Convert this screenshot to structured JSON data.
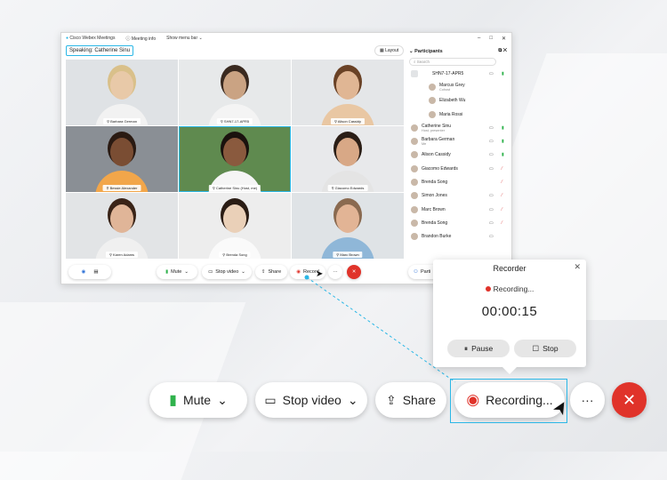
{
  "app": {
    "title": "Cisco Webex Meetings",
    "meeting_info": "Meeting info",
    "menu_bar": "Show menu bar",
    "speaking": "Speaking: Catherine Sinu",
    "layout": "Layout"
  },
  "tiles": [
    {
      "name": "Barbara German",
      "skin": "#e8c9a8",
      "hair": "#d9c08a",
      "shirt": "#f2f2f2",
      "bg": "#dfe2e5"
    },
    {
      "name": "SHN7-17-APR5",
      "skin": "#caa383",
      "hair": "#3a2a20",
      "shirt": "#f4f4f4",
      "bg": "#e7e9ea"
    },
    {
      "name": "Alison Cassidy",
      "skin": "#e0b694",
      "hair": "#6a4226",
      "shirt": "#e9c7a3",
      "bg": "#e4e6e8"
    },
    {
      "name": "Bessie Alexander",
      "skin": "#7a4d33",
      "hair": "#2a1a12",
      "shirt": "#f2a64a",
      "bg": "#8a8f95"
    },
    {
      "name": "Catherine Sinu (Host, me)",
      "skin": "#8a5a3e",
      "hair": "#1a120e",
      "shirt": "#f5f5f5",
      "bg": "#5f8a4f"
    },
    {
      "name": "Giacomo Edwards",
      "skin": "#d8a886",
      "hair": "#2b1e16",
      "shirt": "#e4e4e4",
      "bg": "#e8e9eb"
    },
    {
      "name": "Karen Adams",
      "skin": "#e0b598",
      "hair": "#3a2418",
      "shirt": "#f0f0f0",
      "bg": "#e2e4e6"
    },
    {
      "name": "Brenda Song",
      "skin": "#ead0b8",
      "hair": "#2a1c14",
      "shirt": "#fafafa",
      "bg": "#ededed"
    },
    {
      "name": "Marc Brown",
      "skin": "#e2b495",
      "hair": "#8a6a50",
      "shirt": "#8fb7d8",
      "bg": "#dfe3e6"
    }
  ],
  "participants": {
    "title": "Participants",
    "search_placeholder": "Search",
    "items": [
      {
        "name": "SHN7-17-APR5",
        "sub": "",
        "cam": "video",
        "mic": "on"
      },
      {
        "name": "Marcus Grey",
        "sub": "Cohost",
        "cam": "",
        "mic": "",
        "indent": true
      },
      {
        "name": "Elizabeth Wu",
        "sub": "",
        "cam": "",
        "mic": "",
        "indent": true,
        "initials": "EW"
      },
      {
        "name": "Maria Rossi",
        "sub": "",
        "cam": "",
        "mic": "",
        "indent": true
      },
      {
        "name": "Catherine Sinu",
        "sub": "Host, presenter",
        "cam": "video",
        "mic": "on"
      },
      {
        "name": "Barbara German",
        "sub": "Me",
        "cam": "video",
        "mic": "on"
      },
      {
        "name": "Alison Cassidy",
        "sub": "",
        "cam": "video",
        "mic": "on"
      },
      {
        "name": "Giacomo Edwards",
        "sub": "",
        "cam": "video",
        "mic": "muted"
      },
      {
        "name": "Brenda Song",
        "sub": "",
        "cam": "",
        "mic": "muted"
      },
      {
        "name": "Simon Jones",
        "sub": "",
        "cam": "video",
        "mic": "muted"
      },
      {
        "name": "Marc Brown",
        "sub": "",
        "cam": "video",
        "mic": "muted"
      },
      {
        "name": "Brenda Song",
        "sub": "",
        "cam": "video",
        "mic": "muted"
      },
      {
        "name": "Brandon Burke",
        "sub": "",
        "cam": "video",
        "mic": ""
      }
    ]
  },
  "small_toolbar": {
    "mute": "Mute",
    "stop_video": "Stop video",
    "share": "Share",
    "record": "Record",
    "more": "···",
    "participants": "Parti"
  },
  "recorder": {
    "title": "Recorder",
    "status": "Recording...",
    "timer": "00:00:15",
    "pause": "Pause",
    "stop": "Stop"
  },
  "big_toolbar": {
    "mute": "Mute",
    "stop_video": "Stop video",
    "share": "Share",
    "recording": "Recording...",
    "more": "···"
  },
  "colors": {
    "accent": "#2bb7e6",
    "record_red": "#e0332a",
    "end_red": "#e0332a",
    "mic_green": "#2fb24c",
    "muted_red": "#e05555"
  }
}
